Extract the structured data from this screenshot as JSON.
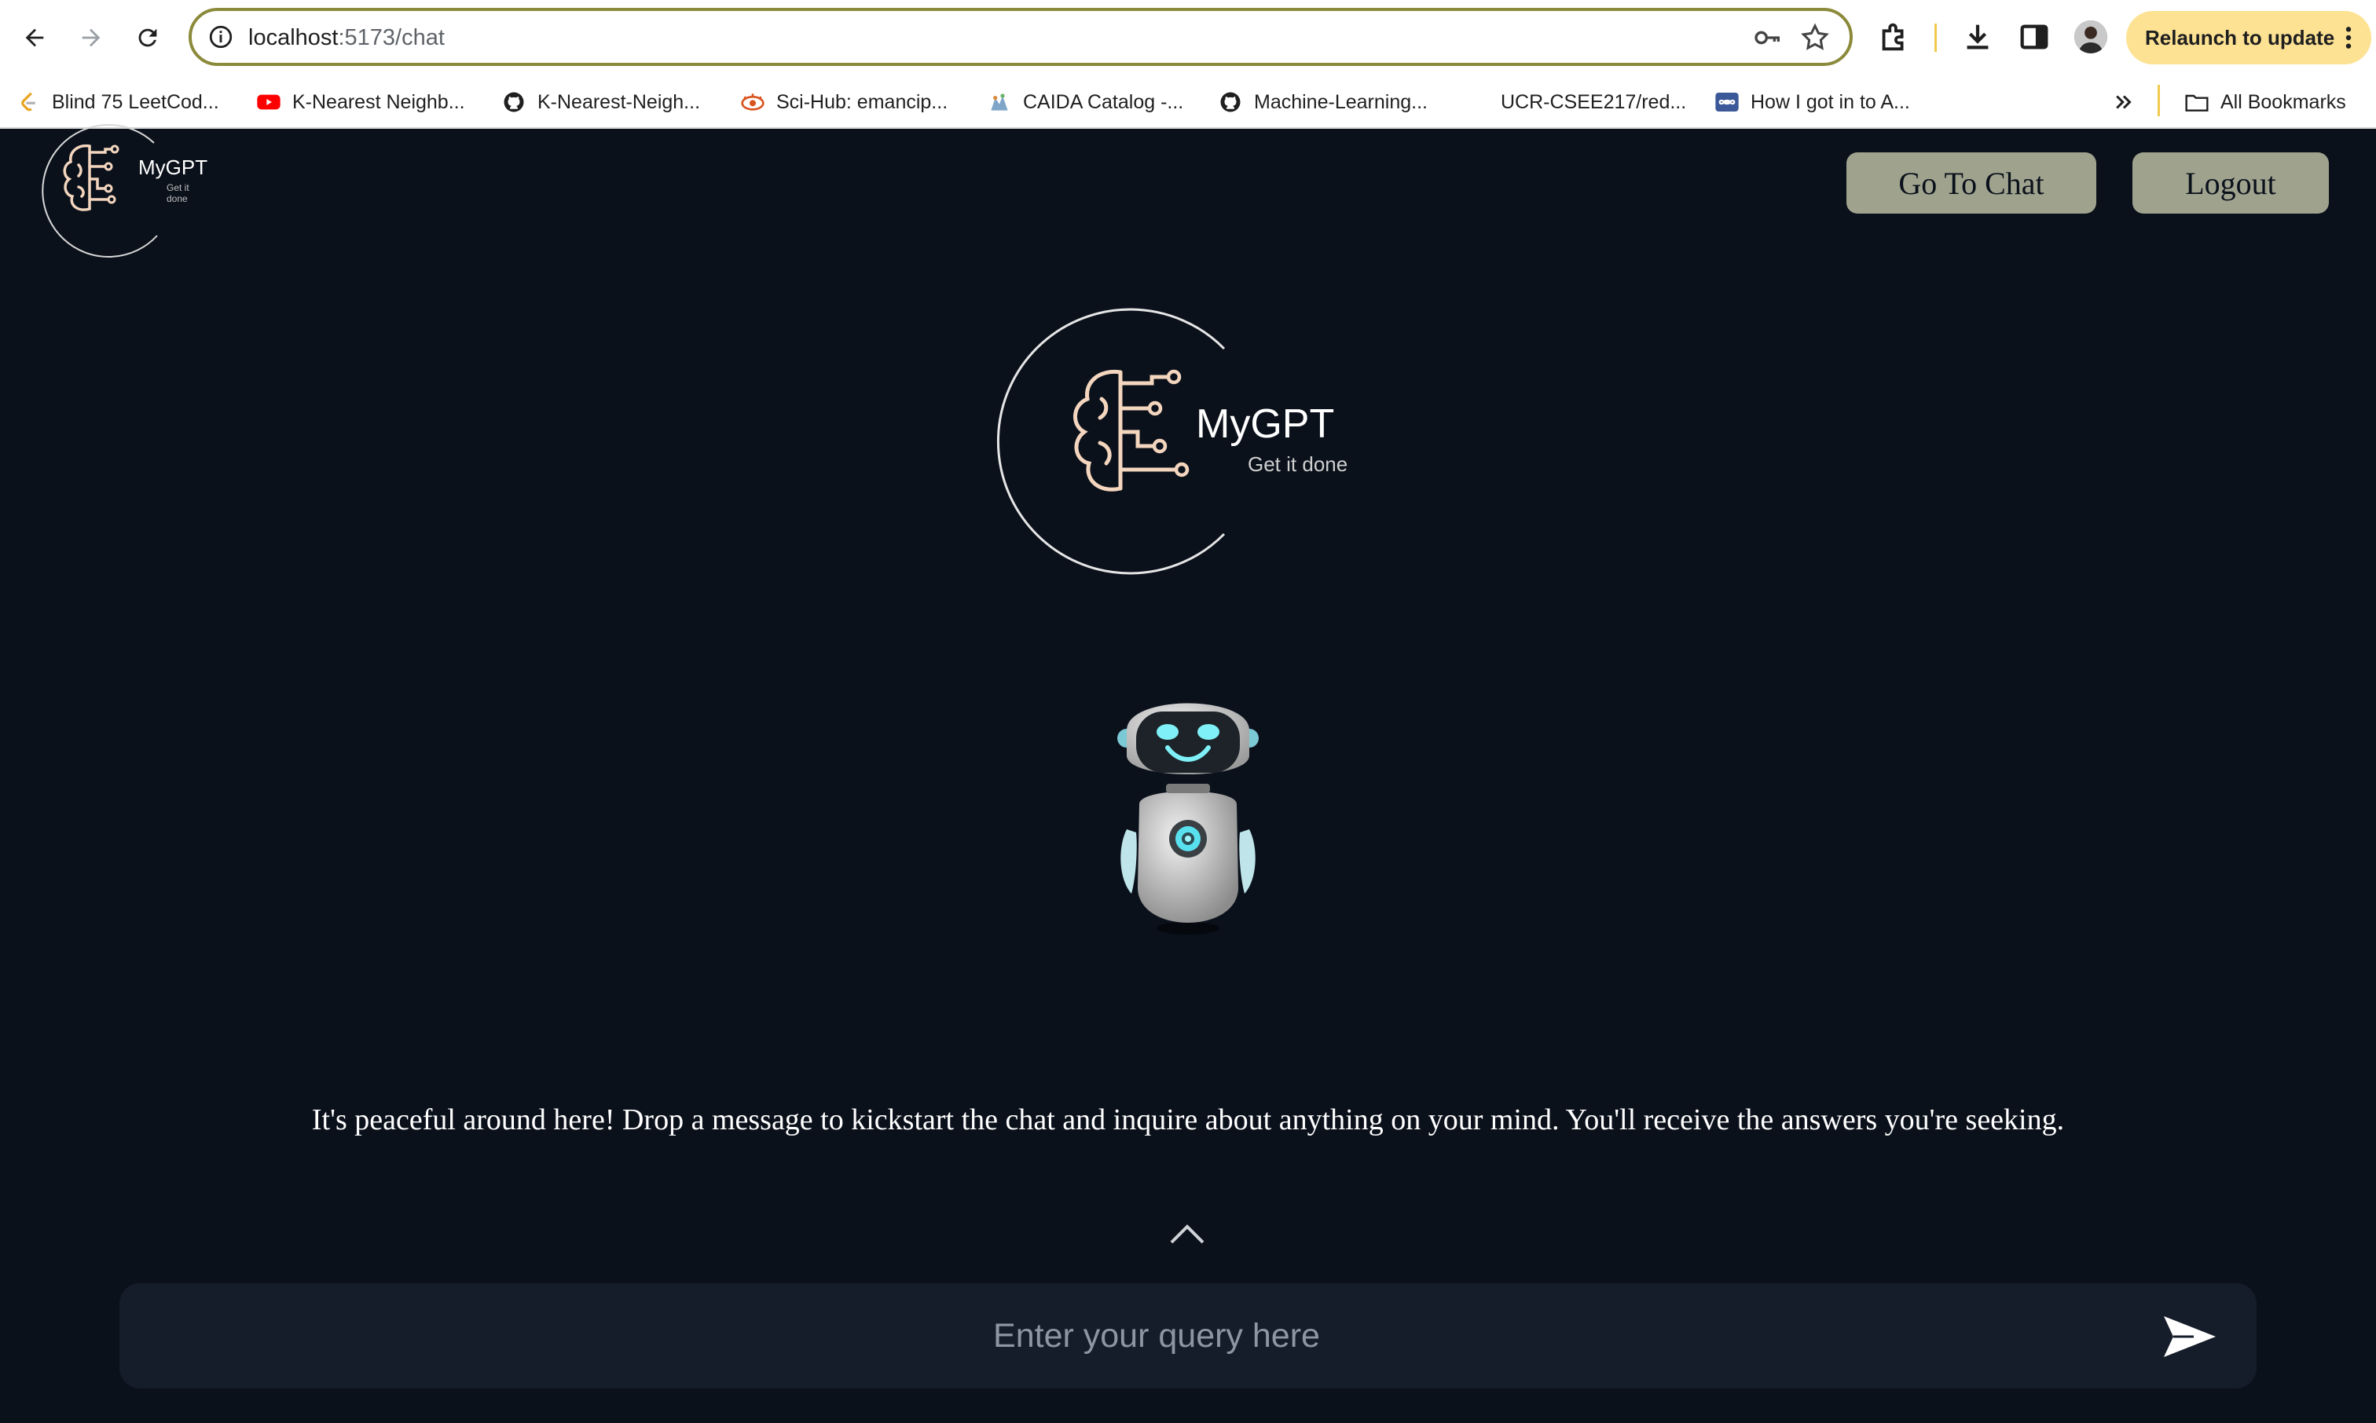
{
  "browser": {
    "url_host": "localhost",
    "url_path": ":5173/chat",
    "relaunch_label": "Relaunch to update",
    "bookmarks": [
      {
        "label": "Blind 75 LeetCod...",
        "icon": "leetcode-icon"
      },
      {
        "label": "K-Nearest Neighb...",
        "icon": "youtube-icon"
      },
      {
        "label": "K-Nearest-Neigh...",
        "icon": "github-icon"
      },
      {
        "label": "Sci-Hub: emancip...",
        "icon": "scihub-icon"
      },
      {
        "label": "CAIDA Catalog -...",
        "icon": "caida-icon"
      },
      {
        "label": "Machine-Learning...",
        "icon": "github-icon"
      },
      {
        "label": "UCR-CSEE217/red...",
        "icon": "none"
      },
      {
        "label": "How I got in to A...",
        "icon": "infinity-icon"
      }
    ],
    "all_bookmarks_label": "All Bookmarks"
  },
  "header": {
    "logo_title": "MyGPT",
    "logo_tagline": "Get it done",
    "go_to_chat_label": "Go To Chat",
    "logout_label": "Logout"
  },
  "hero": {
    "logo_title": "MyGPT",
    "logo_tagline": "Get it done"
  },
  "chat": {
    "empty_message": "It's peaceful around here! Drop a message to kickstart the chat and inquire about anything on your mind. You'll receive the answers you're seeking.",
    "input_placeholder": "Enter your query here"
  },
  "colors": {
    "background": "#0b111b",
    "button_bg": "#9fa38e",
    "logo_accent": "#f4d6bf",
    "input_bg": "#151d2a",
    "relaunch_bg": "#fde293"
  }
}
